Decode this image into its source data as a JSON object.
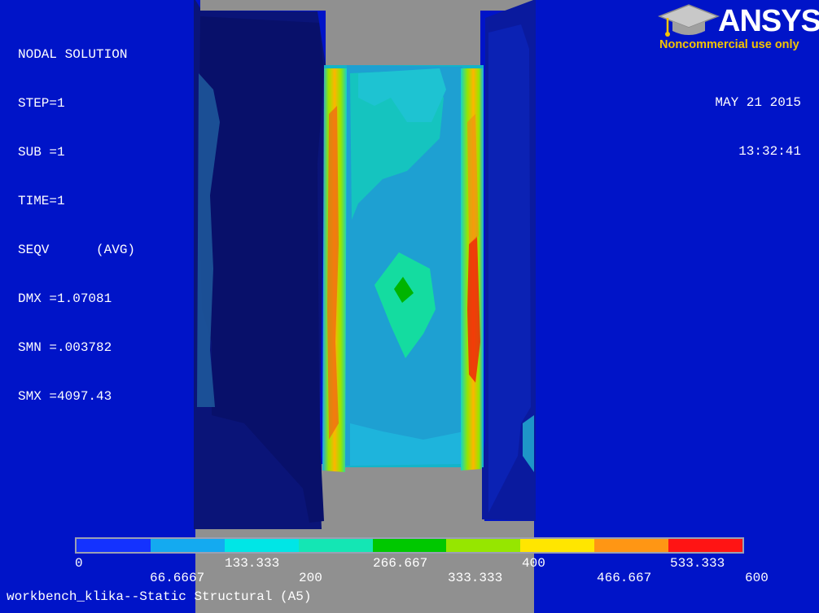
{
  "header": {
    "title": "NODAL SOLUTION",
    "lines": [
      "STEP=1",
      "SUB =1",
      "TIME=1",
      "SEQV      (AVG)",
      "DMX =1.07081",
      "SMN =.003782",
      "SMX =4097.43"
    ]
  },
  "datetime": {
    "date": "MAY 21 2015",
    "time": "13:32:41"
  },
  "logo": {
    "word": "ANSYS",
    "subtitle": "Noncommercial use only",
    "icon": "graduation-cap-icon"
  },
  "legend": {
    "colors": [
      "#1432ff",
      "#14aaf0",
      "#00e6e6",
      "#14e6b4",
      "#00c800",
      "#96e600",
      "#ffe600",
      "#ff9614",
      "#ff1414"
    ],
    "ticks_top": [
      "0",
      "133.333",
      "266.667",
      "400",
      "533.333"
    ],
    "ticks_bottom": [
      "66.6667",
      "200",
      "333.333",
      "466.667",
      "600"
    ]
  },
  "footer": {
    "label": "workbench_klika--Static Structural (A5)"
  },
  "colors": {
    "background": "#0014c8",
    "gray_part": "#909090",
    "text": "#ffffff",
    "logo_yellow": "#f5c400"
  }
}
